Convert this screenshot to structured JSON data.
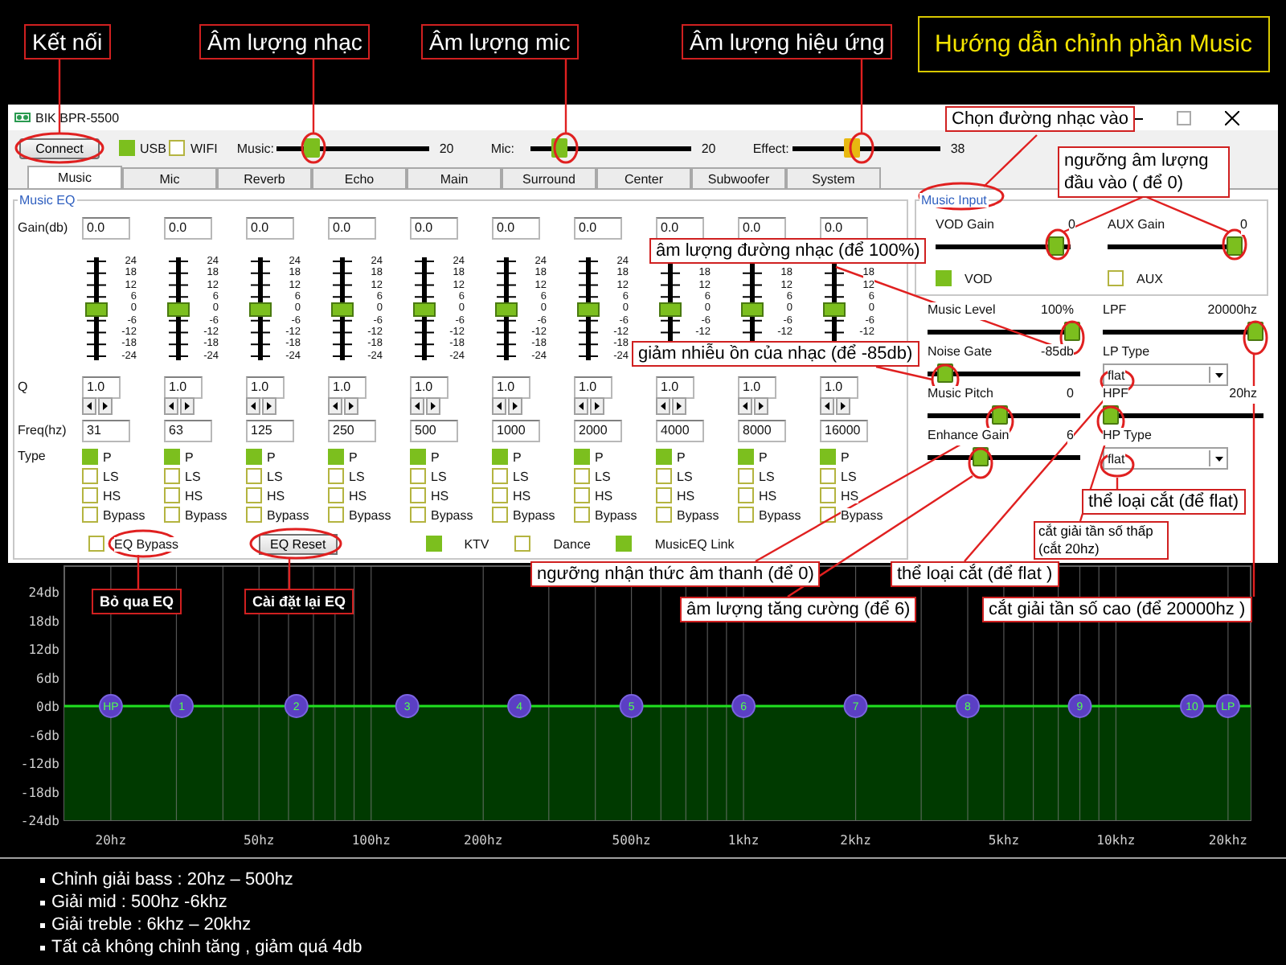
{
  "heading": "Hướng dẫn chỉnh phần Music",
  "window": {
    "title": "BIK BPR-5500"
  },
  "toolbar": {
    "connect_button": "Connect",
    "interfaces": [
      {
        "label": "USB",
        "checked": true
      },
      {
        "label": "WIFI",
        "checked": false
      }
    ],
    "sliders": [
      {
        "label": "Music:",
        "value": "20",
        "level": 0.2,
        "color": "#7cbf1e"
      },
      {
        "label": "Mic:",
        "value": "20",
        "level": 0.14,
        "color": "#7cbf1e"
      },
      {
        "label": "Effect:",
        "value": "38",
        "level": 0.38,
        "color": "#e8b810"
      }
    ]
  },
  "tabs": [
    {
      "label": "Music",
      "selected": true
    },
    {
      "label": "Mic",
      "selected": false
    },
    {
      "label": "Reverb",
      "selected": false
    },
    {
      "label": "Echo",
      "selected": false
    },
    {
      "label": "Main",
      "selected": false
    },
    {
      "label": "Surround",
      "selected": false
    },
    {
      "label": "Center",
      "selected": false
    },
    {
      "label": "Subwoofer",
      "selected": false
    },
    {
      "label": "System",
      "selected": false
    }
  ],
  "music_eq": {
    "title": "Music EQ",
    "row_labels": [
      "Gain(db)",
      "Q",
      "Freq(hz)",
      "Type"
    ],
    "bands": [
      {
        "gain": "0.0",
        "level": 0.5,
        "q": "1.0",
        "freq": "31",
        "scale_upper": [
          "24",
          "18",
          "12",
          "6"
        ],
        "scale_zero": "0",
        "scale_lower": [
          "-6",
          "-12",
          "-18",
          "-24"
        ],
        "types": [
          {
            "label": "P",
            "checked": true
          },
          {
            "label": "LS",
            "checked": false
          },
          {
            "label": "HS",
            "checked": false
          },
          {
            "label": "Bypass",
            "checked": false
          }
        ]
      },
      {
        "gain": "0.0",
        "level": 0.5,
        "q": "1.0",
        "freq": "63",
        "scale_upper": [
          "24",
          "18",
          "12",
          "6"
        ],
        "scale_zero": "0",
        "scale_lower": [
          "-6",
          "-12",
          "-18",
          "-24"
        ],
        "types": [
          {
            "label": "P",
            "checked": true
          },
          {
            "label": "LS",
            "checked": false
          },
          {
            "label": "HS",
            "checked": false
          },
          {
            "label": "Bypass",
            "checked": false
          }
        ]
      },
      {
        "gain": "0.0",
        "level": 0.5,
        "q": "1.0",
        "freq": "125",
        "scale_upper": [
          "24",
          "18",
          "12",
          "6"
        ],
        "scale_zero": "0",
        "scale_lower": [
          "-6",
          "-12",
          "-18",
          "-24"
        ],
        "types": [
          {
            "label": "P",
            "checked": true
          },
          {
            "label": "LS",
            "checked": false
          },
          {
            "label": "HS",
            "checked": false
          },
          {
            "label": "Bypass",
            "checked": false
          }
        ]
      },
      {
        "gain": "0.0",
        "level": 0.5,
        "q": "1.0",
        "freq": "250",
        "scale_upper": [
          "24",
          "18",
          "12",
          "6"
        ],
        "scale_zero": "0",
        "scale_lower": [
          "-6",
          "-12",
          "-18",
          "-24"
        ],
        "types": [
          {
            "label": "P",
            "checked": true
          },
          {
            "label": "LS",
            "checked": false
          },
          {
            "label": "HS",
            "checked": false
          },
          {
            "label": "Bypass",
            "checked": false
          }
        ]
      },
      {
        "gain": "0.0",
        "level": 0.5,
        "q": "1.0",
        "freq": "500",
        "scale_upper": [
          "24",
          "18",
          "12",
          "6"
        ],
        "scale_zero": "0",
        "scale_lower": [
          "-6",
          "-12",
          "-18",
          "-24"
        ],
        "types": [
          {
            "label": "P",
            "checked": true
          },
          {
            "label": "LS",
            "checked": false
          },
          {
            "label": "HS",
            "checked": false
          },
          {
            "label": "Bypass",
            "checked": false
          }
        ]
      },
      {
        "gain": "0.0",
        "level": 0.5,
        "q": "1.0",
        "freq": "1000",
        "scale_upper": [
          "24",
          "18",
          "12",
          "6"
        ],
        "scale_zero": "0",
        "scale_lower": [
          "-6",
          "-12",
          "-18",
          "-24"
        ],
        "types": [
          {
            "label": "P",
            "checked": true
          },
          {
            "label": "LS",
            "checked": false
          },
          {
            "label": "HS",
            "checked": false
          },
          {
            "label": "Bypass",
            "checked": false
          }
        ]
      },
      {
        "gain": "0.0",
        "level": 0.5,
        "q": "1.0",
        "freq": "2000",
        "scale_upper": [
          "24",
          "18",
          "12",
          "6"
        ],
        "scale_zero": "0",
        "scale_lower": [
          "-6",
          "-12",
          "-18",
          "-24"
        ],
        "types": [
          {
            "label": "P",
            "checked": true
          },
          {
            "label": "LS",
            "checked": false
          },
          {
            "label": "HS",
            "checked": false
          },
          {
            "label": "Bypass",
            "checked": false
          }
        ]
      },
      {
        "gain": "0.0",
        "level": 0.5,
        "q": "1.0",
        "freq": "4000",
        "scale_upper": [
          "18",
          "12",
          "6"
        ],
        "scale_zero": "0",
        "scale_lower": [
          "-6",
          "-12"
        ],
        "types": [
          {
            "label": "P",
            "checked": true
          },
          {
            "label": "LS",
            "checked": false
          },
          {
            "label": "HS",
            "checked": false
          },
          {
            "label": "Bypass",
            "checked": false
          }
        ]
      },
      {
        "gain": "0.0",
        "level": 0.5,
        "q": "1.0",
        "freq": "8000",
        "scale_upper": [
          "18",
          "12",
          "6"
        ],
        "scale_zero": "0",
        "scale_lower": [
          "-6",
          "-12"
        ],
        "types": [
          {
            "label": "P",
            "checked": true
          },
          {
            "label": "LS",
            "checked": false
          },
          {
            "label": "HS",
            "checked": false
          },
          {
            "label": "Bypass",
            "checked": false
          }
        ]
      },
      {
        "gain": "0.0",
        "level": 0.5,
        "q": "1.0",
        "freq": "16000",
        "scale_upper": [
          "18",
          "12",
          "6"
        ],
        "scale_zero": "0",
        "scale_lower": [
          "-6",
          "-12"
        ],
        "types": [
          {
            "label": "P",
            "checked": true
          },
          {
            "label": "LS",
            "checked": false
          },
          {
            "label": "HS",
            "checked": false
          },
          {
            "label": "Bypass",
            "checked": false
          }
        ]
      }
    ],
    "bypass": {
      "label": "EQ Bypass",
      "checked": false
    },
    "reset_button": "EQ Reset",
    "options": [
      {
        "label": "KTV",
        "checked": true
      },
      {
        "label": "Dance",
        "checked": false
      },
      {
        "label": "MusicEQ Link",
        "checked": true
      }
    ]
  },
  "music_input": {
    "title": "Music Input",
    "gains": [
      {
        "label": "VOD Gain",
        "value": "0",
        "level": 0.95
      },
      {
        "label": "AUX Gain",
        "value": "0",
        "level": 1
      }
    ],
    "sources": [
      {
        "label": "VOD",
        "checked": true
      },
      {
        "label": "AUX",
        "checked": false
      }
    ]
  },
  "controls": [
    {
      "kind": "slider",
      "label": "Music Level",
      "value": "100%",
      "level": 1
    },
    {
      "kind": "slider",
      "label": "LPF",
      "value": "20000hz",
      "level": 1
    },
    {
      "kind": "slider",
      "label": "Noise Gate",
      "value": "-85db",
      "level": 0.07
    },
    {
      "kind": "select",
      "label": "LP Type",
      "value": "flat"
    },
    {
      "kind": "slider",
      "label": "Music Pitch",
      "value": "0",
      "level": 0.47
    },
    {
      "kind": "slider",
      "label": "HPF",
      "value": "20hz",
      "level": 0
    },
    {
      "kind": "slider",
      "label": "Enhance Gain",
      "value": "6",
      "level": 0.33
    },
    {
      "kind": "select",
      "label": "HP Type",
      "value": "flat"
    }
  ],
  "chart": {
    "nodes": [
      "HP",
      "1",
      "2",
      "3",
      "4",
      "5",
      "6",
      "7",
      "8",
      "9",
      "10",
      "LP"
    ],
    "y_labels": [
      "24db",
      "18db",
      "12db",
      "6db",
      "0db",
      "-6db",
      "-12db",
      "-18db",
      "-24db"
    ],
    "x_labels": [
      "20hz",
      "50hz",
      "100hz",
      "200hz",
      "500hz",
      "1khz",
      "2khz",
      "5khz",
      "10khz",
      "20khz"
    ]
  },
  "callouts": [
    {
      "kind": "dark",
      "text": "Kết nối"
    },
    {
      "kind": "dark",
      "text": "Âm lượng nhạc"
    },
    {
      "kind": "dark",
      "text": "Âm lượng mic"
    },
    {
      "kind": "dark",
      "text": "Âm lượng hiệu ứng"
    },
    {
      "kind": "light",
      "text": "Chọn đường nhạc vào"
    },
    {
      "kind": "light",
      "text": "ngưỡng âm lượng đầu vào ( để 0)"
    },
    {
      "kind": "light",
      "text": "âm lượng đường nhạc (để 100%)"
    },
    {
      "kind": "light",
      "text": "giảm nhiễu ồn của nhạc (để -85db)"
    },
    {
      "kind": "light",
      "text": "thể loại cắt (để flat)"
    },
    {
      "kind": "small",
      "text": "cắt giải tần số thấp (cắt 20hz)"
    },
    {
      "kind": "light",
      "text": "ngưỡng nhận thức âm thanh (để 0)"
    },
    {
      "kind": "light",
      "text": "thể loại cắt (để flat )"
    },
    {
      "kind": "tag",
      "text": "Bỏ qua EQ"
    },
    {
      "kind": "tag",
      "text": "Cài đặt lại EQ"
    },
    {
      "kind": "light",
      "text": "âm lượng tăng cường (để 6)"
    },
    {
      "kind": "light",
      "text": "cắt giải tần số cao (để 20000hz )"
    }
  ],
  "notes": [
    "Chỉnh giải bass : 20hz – 500hz",
    "Giải mid : 500hz -6khz",
    "Giải treble : 6khz – 20khz",
    "Tất cả không chỉnh tăng , giảm quá 4db"
  ]
}
